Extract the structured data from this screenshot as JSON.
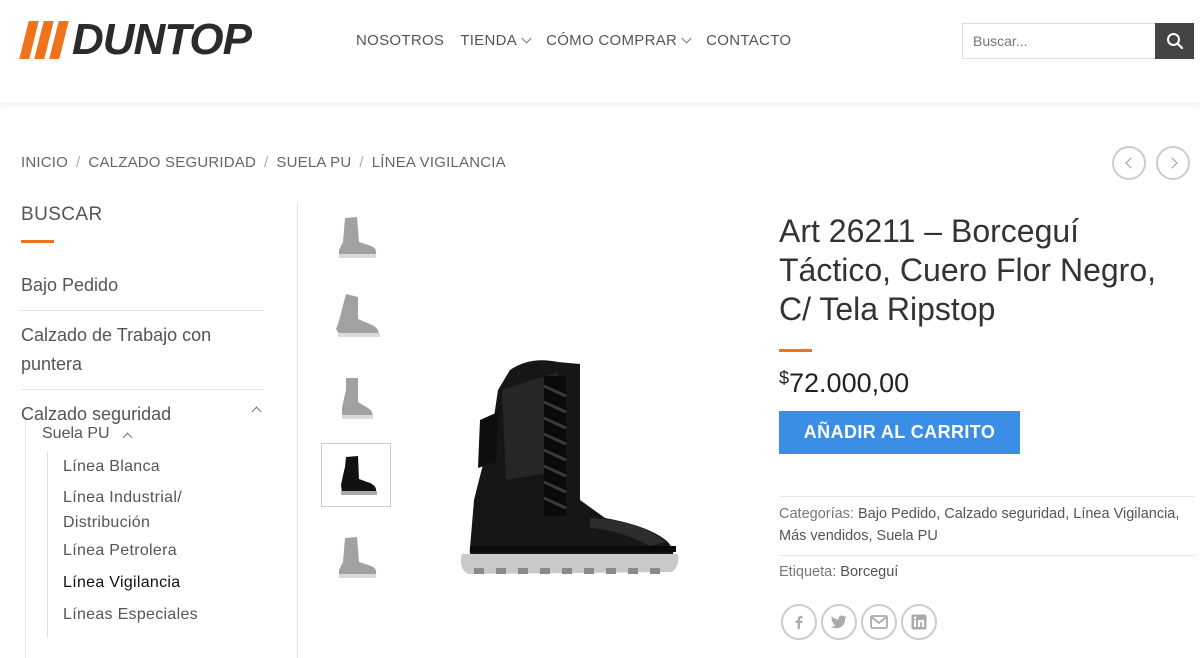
{
  "header": {
    "logo_text": "DUNTOP",
    "nav": [
      {
        "label": "NOSOTROS",
        "has_dropdown": false
      },
      {
        "label": "TIENDA",
        "has_dropdown": true
      },
      {
        "label": "CÓMO COMPRAR",
        "has_dropdown": true
      },
      {
        "label": "CONTACTO",
        "has_dropdown": false
      }
    ],
    "search_placeholder": "Buscar..."
  },
  "breadcrumb": [
    "INICIO",
    "CALZADO SEGURIDAD",
    "SUELA PU",
    "LÍNEA VIGILANCIA"
  ],
  "sidebar": {
    "title": "BUSCAR",
    "items": [
      "Bajo Pedido",
      "Calzado de Trabajo con puntera",
      "Calzado seguridad"
    ],
    "sub_item": "Suela PU",
    "sub_sub_items": [
      "Línea Blanca",
      "Línea Industrial/ Distribución",
      "Línea Petrolera",
      "Línea Vigilancia",
      "Líneas Especiales"
    ],
    "active_item": "Línea Vigilancia"
  },
  "product": {
    "title": "Art 26211 – Borceguí Táctico, Cuero Flor Negro, C/ Tela Ripstop",
    "currency": "$",
    "price": "72.000,00",
    "add_to_cart": "AÑADIR AL CARRITO",
    "categories_label": "Categorías:",
    "categories": [
      "Bajo Pedido",
      "Calzado seguridad",
      "Línea Vigilancia",
      "Más vendidos",
      "Suela PU"
    ],
    "tag_label": "Etiqueta:",
    "tag": "Borceguí"
  },
  "share_icons": [
    "facebook-icon",
    "twitter-icon",
    "email-icon",
    "linkedin-icon"
  ],
  "colors": {
    "accent": "#f0731c",
    "button": "#3a8ee6",
    "logo_dark": "#2b2b2b"
  }
}
